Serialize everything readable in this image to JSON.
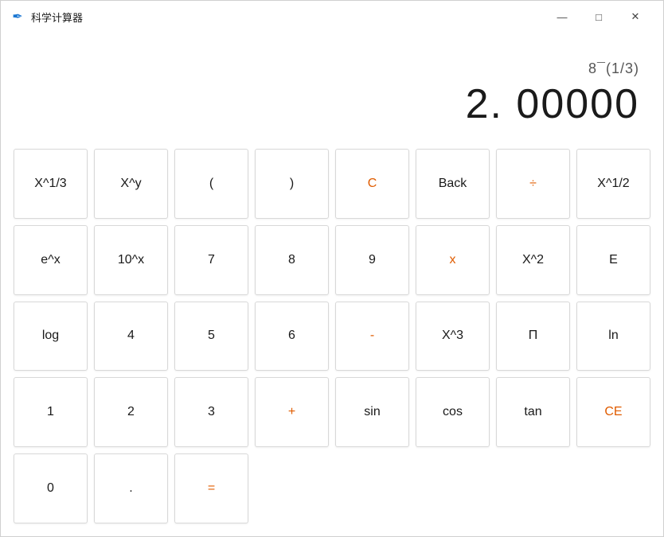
{
  "window": {
    "title": "科学计算器",
    "icon": "✒"
  },
  "titlebar": {
    "minimize": "—",
    "maximize": "□",
    "close": "✕"
  },
  "display": {
    "expression": "8¯(1/3)",
    "result": "2. 00000"
  },
  "buttons": [
    [
      {
        "label": "X^1/3",
        "type": "normal"
      },
      {
        "label": "X^y",
        "type": "normal"
      },
      {
        "label": "(",
        "type": "normal"
      },
      {
        "label": ")",
        "type": "normal"
      },
      {
        "label": "C",
        "type": "orange"
      },
      {
        "label": "Back",
        "type": "normal"
      },
      {
        "label": "÷",
        "type": "operator"
      }
    ],
    [
      {
        "label": "X^1/2",
        "type": "normal"
      },
      {
        "label": "e^x",
        "type": "normal"
      },
      {
        "label": "10^x",
        "type": "normal"
      },
      {
        "label": "7",
        "type": "normal"
      },
      {
        "label": "8",
        "type": "normal"
      },
      {
        "label": "9",
        "type": "normal"
      },
      {
        "label": "x",
        "type": "operator"
      }
    ],
    [
      {
        "label": "X^2",
        "type": "normal"
      },
      {
        "label": "E",
        "type": "normal"
      },
      {
        "label": "log",
        "type": "normal"
      },
      {
        "label": "4",
        "type": "normal"
      },
      {
        "label": "5",
        "type": "normal"
      },
      {
        "label": "6",
        "type": "normal"
      },
      {
        "label": "-",
        "type": "operator"
      }
    ],
    [
      {
        "label": "X^3",
        "type": "normal"
      },
      {
        "label": "П",
        "type": "normal"
      },
      {
        "label": "ln",
        "type": "normal"
      },
      {
        "label": "1",
        "type": "normal"
      },
      {
        "label": "2",
        "type": "normal"
      },
      {
        "label": "3",
        "type": "normal"
      },
      {
        "label": "+",
        "type": "operator"
      }
    ],
    [
      {
        "label": "sin",
        "type": "normal"
      },
      {
        "label": "cos",
        "type": "normal"
      },
      {
        "label": "tan",
        "type": "normal"
      },
      {
        "label": "CE",
        "type": "orange"
      },
      {
        "label": "0",
        "type": "normal"
      },
      {
        "label": ".",
        "type": "normal"
      },
      {
        "label": "=",
        "type": "operator"
      }
    ]
  ]
}
